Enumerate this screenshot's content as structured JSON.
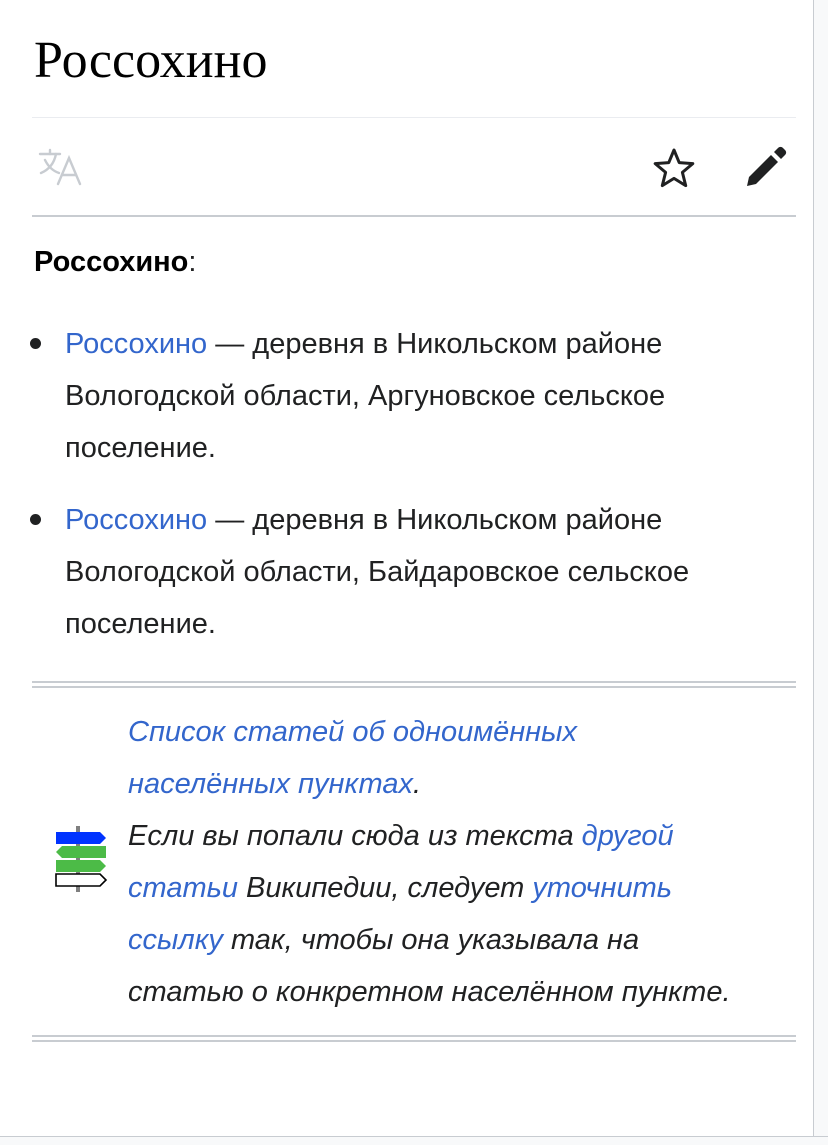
{
  "page": {
    "title": "Россохино"
  },
  "actions": {
    "language_icon": "translate-icon",
    "watch_icon": "star-icon",
    "edit_icon": "pencil-icon"
  },
  "content": {
    "intro_term": "Россохино",
    "intro_punct": ":",
    "items": [
      {
        "link": "Россохино",
        "line1_rest": " — деревня в Никольском районе",
        "line2": "Вологодской области, Аргуновское сельское",
        "line3": "поселение."
      },
      {
        "link": "Россохино",
        "line1_rest": " — деревня в Никольском районе",
        "line2": "Вологодской области, Байдаровское сельское",
        "line3": "поселение."
      }
    ]
  },
  "disambig": {
    "icon": "signpost-icon",
    "list_link_l1": "Список статей об одноимённых",
    "list_link_l2": "населённых пунктах",
    "list_link_end": ".",
    "line3_text": "Если вы попали сюда из текста ",
    "line3_link": "другой",
    "line4_link": "статьи",
    "line4_text": " Википедии, следует ",
    "line4_link2": "уточнить",
    "line5_link": "ссылку",
    "line5_text": " так, чтобы она указывала на",
    "line6_text": "статью о конкретном населённом пункте."
  },
  "colors": {
    "link": "#3366cc",
    "text": "#202122",
    "divider": "#c8ccd1"
  }
}
